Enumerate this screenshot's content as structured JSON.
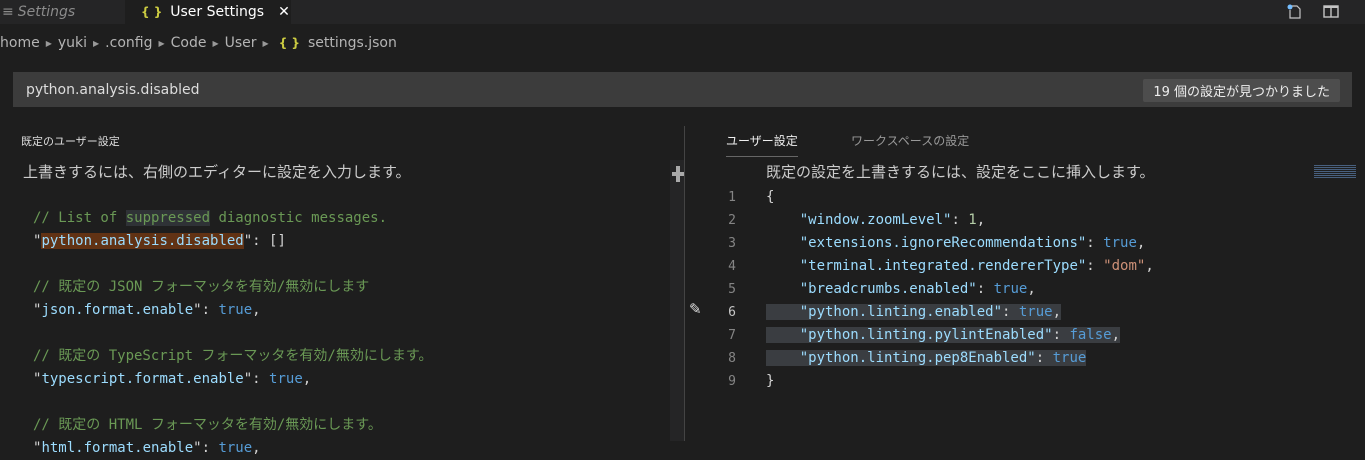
{
  "tabs": [
    {
      "label": "Settings",
      "icon": "list-icon"
    },
    {
      "label": "User Settings",
      "icon": "braces-icon",
      "close": "✕"
    }
  ],
  "breadcrumb": [
    "home",
    "yuki",
    ".config",
    "Code",
    "User",
    "settings.json"
  ],
  "search": {
    "value": "python.analysis.disabled",
    "result_count": "19 個の設定が見つかりました"
  },
  "left": {
    "header": "既定のユーザー設定",
    "description": "上書きするには、右側のエディターに設定を入力します。",
    "lines": [
      [
        [
          "c",
          "// List of "
        ],
        [
          "c hl2",
          "suppressed"
        ],
        [
          "c",
          " diagnostic messages."
        ]
      ],
      [
        [
          "q",
          "\""
        ],
        [
          "k hl",
          "python.analysis.disabled"
        ],
        [
          "q",
          "\""
        ],
        [
          "p",
          ": []"
        ]
      ],
      [],
      [
        [
          "c",
          "// 既定の JSON フォーマッタを有効/無効にします"
        ]
      ],
      [
        [
          "q",
          "\""
        ],
        [
          "k",
          "json.format.enable"
        ],
        [
          "q",
          "\""
        ],
        [
          "p",
          ": "
        ],
        [
          "b",
          "true"
        ],
        [
          "p",
          ","
        ]
      ],
      [],
      [
        [
          "c",
          "// 既定の TypeScript フォーマッタを有効/無効にします。"
        ]
      ],
      [
        [
          "q",
          "\""
        ],
        [
          "k",
          "typescript.format.enable"
        ],
        [
          "q",
          "\""
        ],
        [
          "p",
          ": "
        ],
        [
          "b",
          "true"
        ],
        [
          "p",
          ","
        ]
      ],
      [],
      [
        [
          "c",
          "// 既定の HTML フォーマッタを有効/無効にします。"
        ]
      ],
      [
        [
          "q",
          "\""
        ],
        [
          "k",
          "html.format.enable"
        ],
        [
          "q",
          "\""
        ],
        [
          "p",
          ": "
        ],
        [
          "b",
          "true"
        ],
        [
          "p",
          ","
        ]
      ]
    ]
  },
  "right": {
    "tabs": [
      "ユーザー設定",
      "ワークスペースの設定"
    ],
    "description": "既定の設定を上書きするには、設定をここに挿入します。",
    "lines": [
      [
        [
          "p",
          "{"
        ]
      ],
      [
        [
          "p",
          "    "
        ],
        [
          "k",
          "\"window.zoomLevel\""
        ],
        [
          "p",
          ": "
        ],
        [
          "n",
          "1"
        ],
        [
          "p",
          ","
        ]
      ],
      [
        [
          "p",
          "    "
        ],
        [
          "k",
          "\"extensions.ignoreRecommendations\""
        ],
        [
          "p",
          ": "
        ],
        [
          "b",
          "true"
        ],
        [
          "p",
          ","
        ]
      ],
      [
        [
          "p",
          "    "
        ],
        [
          "k",
          "\"terminal.integrated.rendererType\""
        ],
        [
          "p",
          ": "
        ],
        [
          "s",
          "\"dom\""
        ],
        [
          "p",
          ","
        ]
      ],
      [
        [
          "p",
          "    "
        ],
        [
          "k",
          "\"breadcrumbs.enabled\""
        ],
        [
          "p",
          ": "
        ],
        [
          "b",
          "true"
        ],
        [
          "p",
          ","
        ]
      ],
      [
        [
          "p",
          "    "
        ],
        [
          "k",
          "\"python.linting.enabled\""
        ],
        [
          "p",
          ": "
        ],
        [
          "b",
          "true"
        ],
        [
          "p",
          ","
        ]
      ],
      [
        [
          "p",
          "    "
        ],
        [
          "k",
          "\"python.linting.pylintEnabled\""
        ],
        [
          "p",
          ": "
        ],
        [
          "b",
          "false"
        ],
        [
          "p",
          ","
        ]
      ],
      [
        [
          "p",
          "    "
        ],
        [
          "k",
          "\"python.linting.pep8Enabled\""
        ],
        [
          "p",
          ": "
        ],
        [
          "b",
          "true"
        ]
      ],
      [
        [
          "p",
          "}"
        ]
      ]
    ],
    "line_numbers": [
      "1",
      "2",
      "3",
      "4",
      "5",
      "6",
      "7",
      "8",
      "9"
    ],
    "selected_lines": [
      6,
      7,
      8
    ]
  }
}
